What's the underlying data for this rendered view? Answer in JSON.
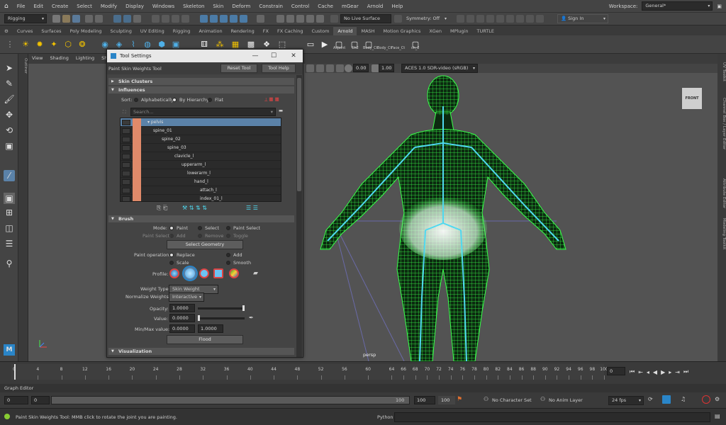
{
  "menubar": {
    "items": [
      "File",
      "Edit",
      "Create",
      "Select",
      "Modify",
      "Display",
      "Windows",
      "Skeleton",
      "Skin",
      "Deform",
      "Constrain",
      "Control",
      "Cache",
      "mGear",
      "Arnold",
      "Help"
    ],
    "workspace_label": "Workspace:",
    "workspace_value": "General*"
  },
  "statusline": {
    "mode": "Rigging",
    "live_surface": "No Live Surface",
    "symmetry": "Symmetry: Off",
    "sign_in": "Sign In"
  },
  "shelf": {
    "tabs": [
      "Curves",
      "Surfaces",
      "Poly Modeling",
      "Sculpting",
      "UV Editing",
      "Rigging",
      "Animation",
      "Rendering",
      "FX",
      "FX Caching",
      "Custom",
      "Arnold",
      "MASH",
      "Motion Graphics",
      "XGen",
      "MPlugin",
      "TURTLE"
    ],
    "active_tab": "Arnold",
    "labels": [
      "AllJoint",
      "Ch2",
      "Body_Ct",
      "Body_Ct",
      "Face_Ct",
      "ch_2"
    ]
  },
  "viewport": {
    "menus": [
      "View",
      "Shading",
      "Lighting",
      "Show"
    ],
    "field_a": "0.00",
    "field_b": "1.00",
    "colorspace": "ACES 1.0 SDR-video (sRGB)",
    "cube_label": "FRONT",
    "camera_label": "persp",
    "outliner_tab": "Outliner",
    "right_tabs": [
      "UV Toolkit",
      "Channel Box / Layer Editor",
      "Attribute Editor",
      "Modeling Toolkit"
    ]
  },
  "tool_settings": {
    "window_title": "Tool Settings",
    "tool_name": "Paint Skin Weights Tool",
    "reset_label": "Reset Tool",
    "help_label": "Tool Help",
    "sections": {
      "skin_clusters": "Skin Clusters",
      "influences": "Influences",
      "brush": "Brush",
      "visualization": "Visualization"
    },
    "sort_label": "Sort:",
    "sort_options": [
      "Alphabetically",
      "By Hierarchy",
      "Flat"
    ],
    "search_placeholder": "Search...",
    "influences": [
      "pelvis",
      "spine_01",
      "spine_02",
      "spine_03",
      "clavicle_l",
      "upperarm_l",
      "lowerarm_l",
      "hand_l",
      "attach_l",
      "index_01_l"
    ],
    "mode_label": "Mode:",
    "mode_options": [
      "Paint",
      "Select",
      "Paint Select"
    ],
    "paint_select_label": "Paint Select:",
    "paint_select_options": [
      "Add",
      "Remove",
      "Toggle"
    ],
    "select_geometry": "Select Geometry",
    "paint_op_label": "Paint operation:",
    "paint_ops": [
      "Replace",
      "Add",
      "Scale",
      "Smooth"
    ],
    "profile_label": "Profile:",
    "weight_type_label": "Weight Type:",
    "weight_type": "Skin Weight",
    "normalize_label": "Normalize Weights:",
    "normalize": "Interactive",
    "opacity_label": "Opacity:",
    "opacity": "1.0000",
    "value_label": "Value:",
    "value": "0.0000",
    "minmax_label": "Min/Max value:",
    "min": "0.0000",
    "max": "1.0000",
    "flood": "Flood"
  },
  "timeline": {
    "ticks": [
      "0",
      "4",
      "8",
      "12",
      "16",
      "20",
      "24",
      "28",
      "32",
      "36",
      "40",
      "44",
      "48",
      "52",
      "56",
      "60",
      "64",
      "66",
      "68",
      "70",
      "72",
      "74",
      "76",
      "78",
      "80",
      "82",
      "84",
      "86",
      "88",
      "90",
      "92",
      "94",
      "96",
      "98",
      "100"
    ],
    "current_frame": "0",
    "end_frame": "100"
  },
  "rangebar": {
    "start": "0",
    "start_range": "0",
    "end_range": "100",
    "end": "100",
    "range_mid": "100",
    "character_set": "No Character Set",
    "anim_layer": "No Anim Layer",
    "fps": "24 fps"
  },
  "graph_editor": "Graph Editor",
  "helpline": {
    "message": "Paint Skin Weights Tool: MMB click to rotate the joint you are painting.",
    "script_lang": "Python"
  },
  "colors": {
    "wire": "#39ff4a",
    "joint": "#4fd9f0",
    "selected_row": "#5b82a8"
  }
}
